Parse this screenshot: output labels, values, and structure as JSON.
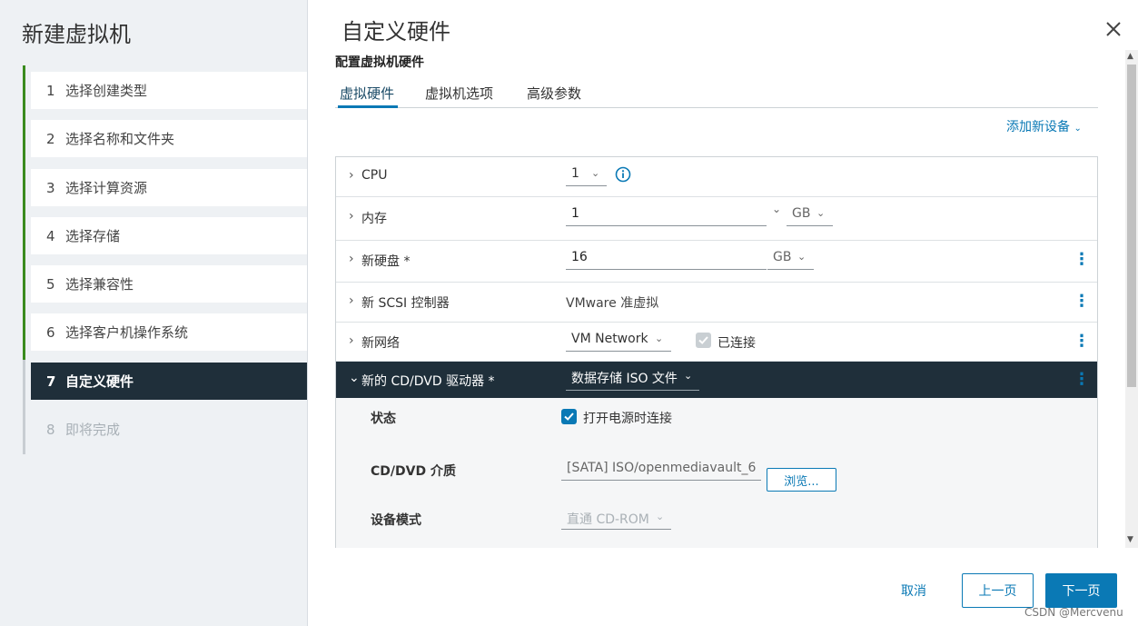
{
  "wizard": {
    "title": "新建虚拟机",
    "steps": [
      {
        "num": "1",
        "label": "选择创建类型"
      },
      {
        "num": "2",
        "label": "选择名称和文件夹"
      },
      {
        "num": "3",
        "label": "选择计算资源"
      },
      {
        "num": "4",
        "label": "选择存储"
      },
      {
        "num": "5",
        "label": "选择兼容性"
      },
      {
        "num": "6",
        "label": "选择客户机操作系统"
      },
      {
        "num": "7",
        "label": "自定义硬件"
      },
      {
        "num": "8",
        "label": "即将完成"
      }
    ]
  },
  "main": {
    "title": "自定义硬件",
    "subtitle": "配置虚拟机硬件",
    "tabs": [
      "虚拟硬件",
      "虚拟机选项",
      "高级参数"
    ],
    "add_device": "添加新设备",
    "hardware": {
      "cpu": {
        "label": "CPU",
        "value": "1"
      },
      "memory": {
        "label": "内存",
        "value": "1",
        "unit": "GB"
      },
      "disk": {
        "label": "新硬盘 *",
        "value": "16",
        "unit": "GB"
      },
      "scsi": {
        "label": "新 SCSI 控制器",
        "value": "VMware 准虚拟"
      },
      "network": {
        "label": "新网络",
        "value": "VM Network",
        "connected_label": "已连接"
      },
      "cdrom": {
        "label": "新的 CD/DVD 驱动器 *",
        "value": "数据存储 ISO 文件",
        "status_label": "状态",
        "status_checkbox": "打开电源时连接",
        "media_label": "CD/DVD 介质",
        "media_value": "[SATA] ISO/openmediavault_6",
        "browse": "浏览...",
        "mode_label": "设备模式",
        "mode_value": "直通 CD-ROM"
      }
    }
  },
  "footer": {
    "cancel": "取消",
    "back": "上一页",
    "next": "下一页"
  },
  "watermark": "CSDN @Mercvenu",
  "colors": {
    "accent": "#0a79b5",
    "dark": "#1f2f3a",
    "done": "#3a8b1e"
  }
}
